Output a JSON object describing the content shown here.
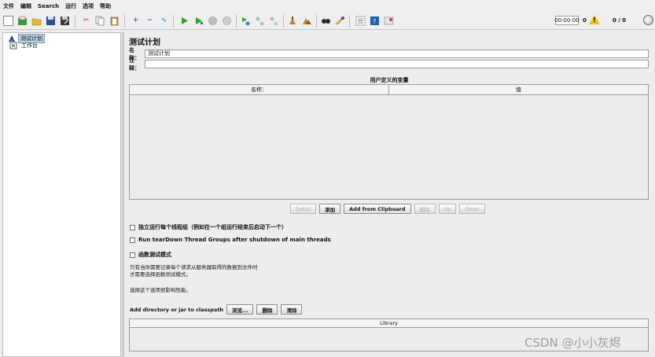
{
  "menu": [
    "文件",
    "编辑",
    "Search",
    "运行",
    "选项",
    "帮助"
  ],
  "toolbar": {
    "icons": [
      "new-icon",
      "templates-icon",
      "open-icon",
      "save-icon",
      "save-as-icon",
      "cut-icon",
      "copy-icon",
      "paste-icon",
      "expand-icon",
      "collapse-icon",
      "toggle-icon",
      "start-icon",
      "start-no-pause-icon",
      "stop-icon",
      "shutdown-icon",
      "remote-start-icon",
      "remote-stop-icon",
      "remote-shutdown-icon",
      "clear-icon",
      "clear-all-icon",
      "search-icon",
      "reset-search-icon",
      "function-helper-icon",
      "help-icon",
      "log-viewer-icon"
    ],
    "timer": "00:00:00",
    "error_count": "0",
    "threads": "0 / 0"
  },
  "tree": {
    "items": [
      {
        "label": "测试计划",
        "selected": true
      },
      {
        "label": "工作台",
        "selected": false
      }
    ]
  },
  "panel": {
    "title": "测试计划",
    "name_label": "名称：",
    "name_value": "测试计划",
    "comment_label": "注释：",
    "comment_value": "",
    "vars_title": "用户定义的变量",
    "vars_columns": [
      "名称：",
      "值"
    ],
    "buttons": [
      "Detail",
      "添加",
      "Add from Clipboard",
      "删除",
      "Up",
      "Down"
    ],
    "checkboxes": [
      "独立运行每个线程组（例如在一个组运行结束后启动下一个）",
      "Run tearDown Thread Groups after shutdown of main threads",
      "函数测试模式"
    ],
    "note_lines": [
      "只有当你需要记录每个请求从服务器取得的数据到文件时",
      "才需要选择函数测试模式。"
    ],
    "note2": "选择这个选项很影响性能。",
    "classpath_label": "Add directory or jar to classpath",
    "classpath_buttons": [
      "浏览...",
      "删除",
      "清除"
    ],
    "library_header": "Library"
  },
  "watermark": "CSDN @小小灰烬"
}
